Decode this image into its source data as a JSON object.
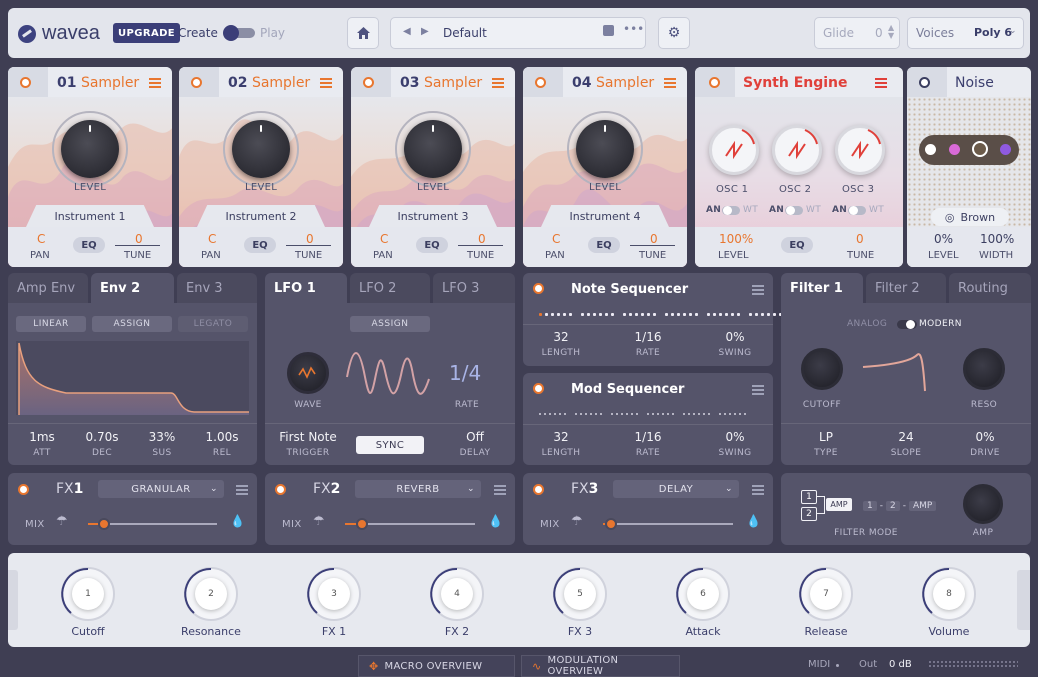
{
  "topbar": {
    "logo": "wavea",
    "upgrade": "UPGRADE",
    "create": "Create",
    "play": "Play",
    "preset": "Default",
    "glide_label": "Glide",
    "glide_value": "0",
    "voices_label": "Voices",
    "voices_value": "Poly 6"
  },
  "samplers": [
    {
      "num": "01",
      "type": "Sampler",
      "level": "LEVEL",
      "instrument": "Instrument 1",
      "pan": "C",
      "pan_label": "PAN",
      "eq": "EQ",
      "tune": "0",
      "tune_label": "TUNE"
    },
    {
      "num": "02",
      "type": "Sampler",
      "level": "LEVEL",
      "instrument": "Instrument 2",
      "pan": "C",
      "pan_label": "PAN",
      "eq": "EQ",
      "tune": "0",
      "tune_label": "TUNE"
    },
    {
      "num": "03",
      "type": "Sampler",
      "level": "LEVEL",
      "instrument": "Instrument 3",
      "pan": "C",
      "pan_label": "PAN",
      "eq": "EQ",
      "tune": "0",
      "tune_label": "TUNE"
    },
    {
      "num": "04",
      "type": "Sampler",
      "level": "LEVEL",
      "instrument": "Instrument 4",
      "pan": "C",
      "pan_label": "PAN",
      "eq": "EQ",
      "tune": "0",
      "tune_label": "TUNE"
    }
  ],
  "synth": {
    "title": "Synth Engine",
    "oscs": [
      {
        "label": "OSC 1",
        "an": "AN",
        "wt": "WT"
      },
      {
        "label": "OSC 2",
        "an": "AN",
        "wt": "WT"
      },
      {
        "label": "OSC 3",
        "an": "AN",
        "wt": "WT"
      }
    ],
    "level": "100%",
    "level_label": "LEVEL",
    "eq": "EQ",
    "tune": "0",
    "tune_label": "TUNE"
  },
  "noise": {
    "title": "Noise",
    "type": "Brown",
    "level": "0%",
    "level_label": "LEVEL",
    "width": "100%",
    "width_label": "WIDTH",
    "dot_colors": [
      "#ffffff",
      "#d96ad8",
      "#6b5a4a",
      "#8f5ae0"
    ]
  },
  "env": {
    "tabs": [
      "Amp Env",
      "Env 2",
      "Env 3"
    ],
    "modes": [
      "LINEAR",
      "ASSIGN",
      "LEGATO"
    ],
    "params": [
      {
        "value": "1ms",
        "label": "ATT"
      },
      {
        "value": "0.70s",
        "label": "DEC"
      },
      {
        "value": "33%",
        "label": "SUS"
      },
      {
        "value": "1.00s",
        "label": "REL"
      }
    ]
  },
  "lfo": {
    "tabs": [
      "LFO 1",
      "LFO 2",
      "LFO 3"
    ],
    "assign": "ASSIGN",
    "wave_label": "WAVE",
    "rate": "1/4",
    "rate_label": "RATE",
    "trigger": "First Note",
    "trigger_label": "TRIGGER",
    "sync": "SYNC",
    "delay": "Off",
    "delay_label": "DELAY"
  },
  "note_seq": {
    "title": "Note Sequencer",
    "length": "32",
    "length_label": "LENGTH",
    "rate": "1/16",
    "rate_label": "RATE",
    "swing": "0%",
    "swing_label": "SWING"
  },
  "mod_seq": {
    "title": "Mod Sequencer",
    "length": "32",
    "length_label": "LENGTH",
    "rate": "1/16",
    "rate_label": "RATE",
    "swing": "0%",
    "swing_label": "SWING"
  },
  "filter": {
    "tabs": [
      "Filter 1",
      "Filter 2",
      "Routing"
    ],
    "analog": "ANALOG",
    "modern": "MODERN",
    "cutoff_label": "CUTOFF",
    "reso_label": "RESO",
    "type": "LP",
    "type_label": "TYPE",
    "slope": "24",
    "slope_label": "SLOPE",
    "drive": "0%",
    "drive_label": "DRIVE"
  },
  "fx": [
    {
      "name": "FX",
      "num": "1",
      "effect": "GRANULAR",
      "mix": "MIX",
      "mix_value": 0.07
    },
    {
      "name": "FX",
      "num": "2",
      "effect": "REVERB",
      "mix": "MIX",
      "mix_value": 0.07
    },
    {
      "name": "FX",
      "num": "3",
      "effect": "DELAY",
      "mix": "MIX",
      "mix_value": 0.0
    }
  ],
  "filter_mode": {
    "one": "1",
    "two": "2",
    "amp_tag": "AMP",
    "seq_1": "1",
    "seq_dash1": "-",
    "seq_2": "2",
    "seq_dash2": "-",
    "seq_amp": "AMP",
    "label": "FILTER MODE",
    "amp_label": "AMP"
  },
  "macros": [
    {
      "num": "1",
      "label": "Cutoff"
    },
    {
      "num": "2",
      "label": "Resonance"
    },
    {
      "num": "3",
      "label": "FX 1"
    },
    {
      "num": "4",
      "label": "FX 2"
    },
    {
      "num": "5",
      "label": "FX 3"
    },
    {
      "num": "6",
      "label": "Attack"
    },
    {
      "num": "7",
      "label": "Release"
    },
    {
      "num": "8",
      "label": "Volume"
    }
  ],
  "bottom": {
    "macro_overview": "MACRO OVERVIEW",
    "modulation_overview": "MODULATION OVERVIEW",
    "midi": "MIDI",
    "out": "Out",
    "out_value": "0 dB"
  },
  "colors": {
    "accent": "#e8762f",
    "brand": "#3b3e78",
    "synth_red": "#e0403a"
  }
}
